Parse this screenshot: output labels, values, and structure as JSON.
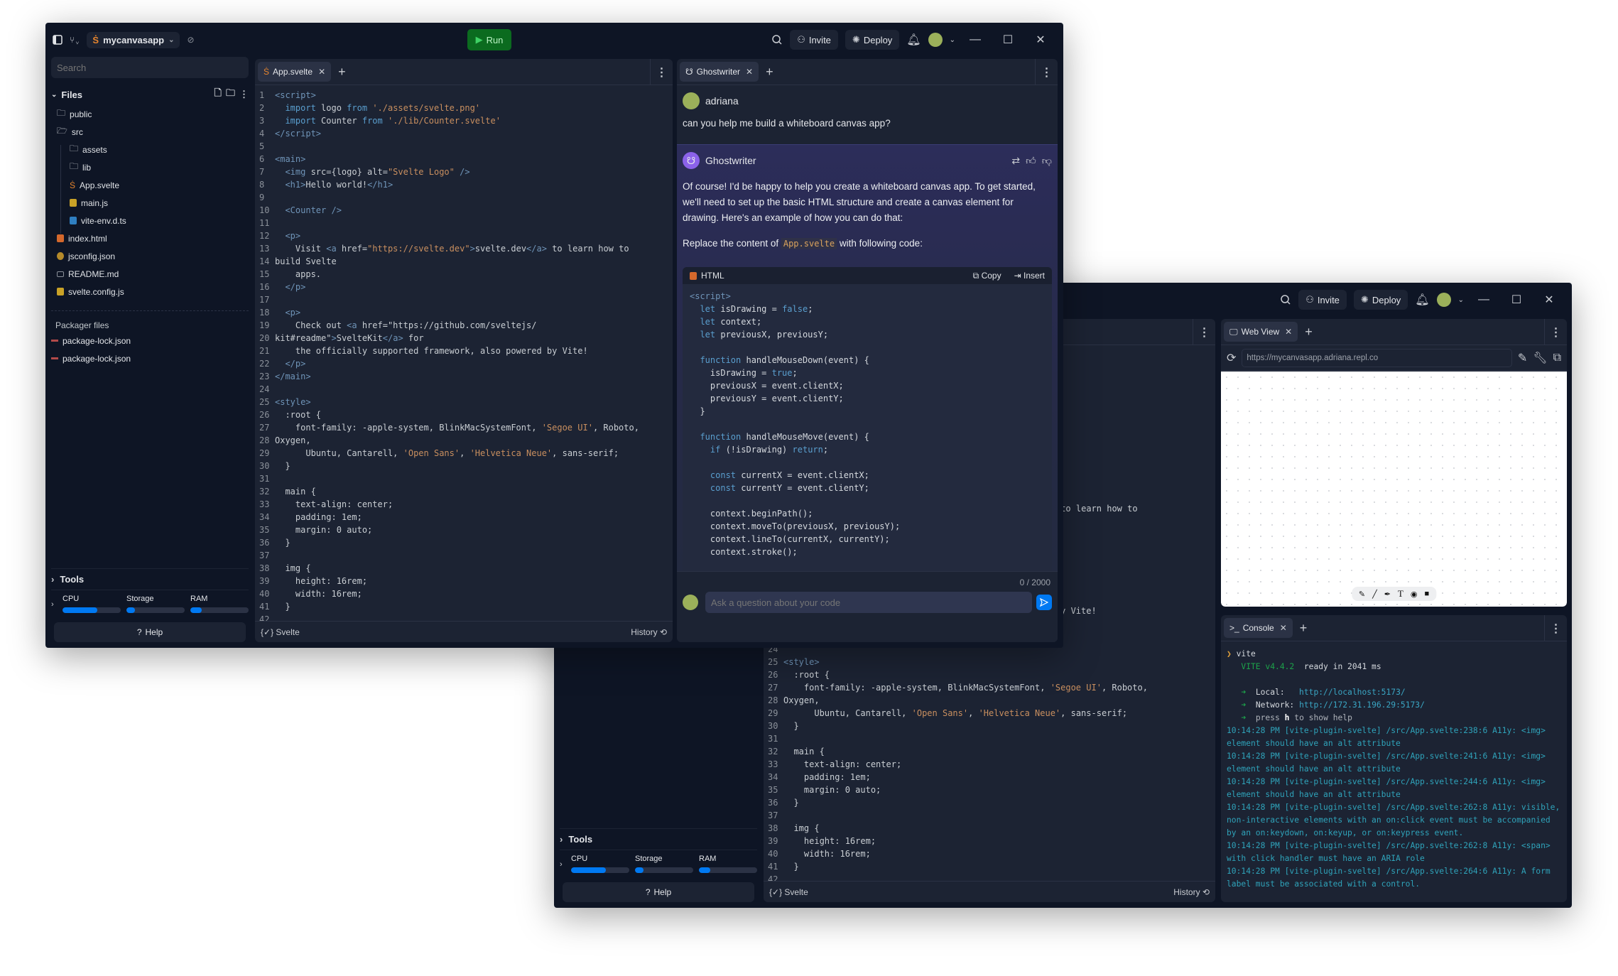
{
  "app": {
    "project_name": "mycanvasapp",
    "run_label": "Run",
    "invite_label": "Invite",
    "deploy_label": "Deploy"
  },
  "sidebar": {
    "search_placeholder": "Search",
    "files_label": "Files",
    "files": [
      {
        "name": "public",
        "icon": "folder-icon"
      },
      {
        "name": "src",
        "icon": "folder-open-icon"
      },
      {
        "name": "assets",
        "icon": "folder-icon"
      },
      {
        "name": "lib",
        "icon": "folder-icon"
      },
      {
        "name": "App.svelte",
        "icon": "svelte-icon"
      },
      {
        "name": "main.js",
        "icon": "js-icon"
      },
      {
        "name": "vite-env.d.ts",
        "icon": "ts-icon"
      },
      {
        "name": "index.html",
        "icon": "html-icon"
      },
      {
        "name": "jsconfig.json",
        "icon": "json-icon"
      },
      {
        "name": "README.md",
        "icon": "markdown-icon"
      },
      {
        "name": "svelte.config.js",
        "icon": "js-icon"
      }
    ],
    "packager_label": "Packager files",
    "packager_files": [
      "package-lock.json",
      "package-lock.json"
    ],
    "tools_label": "Tools",
    "resources": [
      {
        "label": "CPU",
        "usage": 0.6
      },
      {
        "label": "Storage",
        "usage": 0.15
      },
      {
        "label": "RAM",
        "usage": 0.2
      }
    ],
    "help_label": "Help"
  },
  "editor": {
    "tab": "App.svelte",
    "language": "Svelte",
    "history_label": "History",
    "lines": [
      "<script>",
      "  import logo from './assets/svelte.png'",
      "  import Counter from './lib/Counter.svelte'",
      "</script>",
      "",
      "<main>",
      "  <img src={logo} alt=\"Svelte Logo\" />",
      "  <h1>Hello world!</h1>",
      "",
      "  <Counter />",
      "",
      "  <p>",
      "    Visit <a href=\"https://svelte.dev\">svelte.dev</a> to learn how to",
      "build Svelte",
      "    apps.",
      "  </p>",
      "",
      "  <p>",
      "    Check out <a href=\"https://github.com/sveltejs/",
      "kit#readme\">SvelteKit</a> for",
      "    the officially supported framework, also powered by Vite!",
      "  </p>",
      "</main>",
      "",
      "<style>",
      "  :root {",
      "    font-family: -apple-system, BlinkMacSystemFont, 'Segoe UI', Roboto,",
      "Oxygen,",
      "      Ubuntu, Cantarell, 'Open Sans', 'Helvetica Neue', sans-serif;",
      "  }",
      "",
      "  main {",
      "    text-align: center;",
      "    padding: 1em;",
      "    margin: 0 auto;",
      "  }",
      "",
      "  img {",
      "    height: 16rem;",
      "    width: 16rem;",
      "  }",
      ""
    ]
  },
  "ghostwriter": {
    "tab": "Ghostwriter",
    "user_name": "adriana",
    "user_message": "can you help me build a whiteboard canvas app?",
    "assistant_name": "Ghostwriter",
    "response_paragraph": "Of course! I'd be happy to help you create a whiteboard canvas app. To get started, we'll need to set up the basic HTML structure and create a canvas element for drawing. Here's an example of how you can do that:",
    "replace_prefix": "Replace the content of",
    "replace_file": "App.svelte",
    "replace_suffix": "with following code:",
    "code_language": "HTML",
    "copy_label": "Copy",
    "insert_label": "Insert",
    "code": "<script>\n  let isDrawing = false;\n  let context;\n  let previousX, previousY;\n\n  function handleMouseDown(event) {\n    isDrawing = true;\n    previousX = event.clientX;\n    previousY = event.clientY;\n  }\n\n  function handleMouseMove(event) {\n    if (!isDrawing) return;\n\n    const currentX = event.clientX;\n    const currentY = event.clientY;\n\n    context.beginPath();\n    context.moveTo(previousX, previousY);\n    context.lineTo(currentX, currentY);\n    context.stroke();\n\n    previousX = currentX;\n    previousY = currentY;",
    "char_count": "0 / 2000",
    "input_placeholder": "Ask a question about your code"
  },
  "webview": {
    "tab": "Web View",
    "url": "https://mycanvasapp.adriana.repl.co"
  },
  "console": {
    "tab": "Console",
    "command": "vite",
    "vite_version": "VITE v4.4.2",
    "ready_text": "ready in 2041 ms",
    "local_label": "Local:",
    "local_url": "http://localhost:5173/",
    "network_label": "Network:",
    "network_url": "http://172.31.196.29:5173/",
    "help_hint_prefix": "press",
    "help_hint_key": "h",
    "help_hint_suffix": "to show help",
    "logs": [
      "10:14:28 PM [vite-plugin-svelte] /src/App.svelte:238:6 A11y: <img> element should have an alt attribute",
      "10:14:28 PM [vite-plugin-svelte] /src/App.svelte:241:6 A11y: <img> element should have an alt attribute",
      "10:14:28 PM [vite-plugin-svelte] /src/App.svelte:244:6 A11y: <img> element should have an alt attribute",
      "10:14:28 PM [vite-plugin-svelte] /src/App.svelte:262:8 A11y: visible, non-interactive elements with an on:click event must be accompanied by an on:keydown, on:keyup, or on:keypress event.",
      "10:14:28 PM [vite-plugin-svelte] /src/App.svelte:262:8 A11y: <span> with click handler must have an ARIA role",
      "10:14:28 PM [vite-plugin-svelte] /src/App.svelte:264:6 A11y: A form label must be associated with a control."
    ]
  },
  "colors": {
    "run": "#0b6b1f",
    "accent": "#0079f2",
    "avatar": "#9bb05a",
    "ghostwriter": "#8b62ea"
  }
}
